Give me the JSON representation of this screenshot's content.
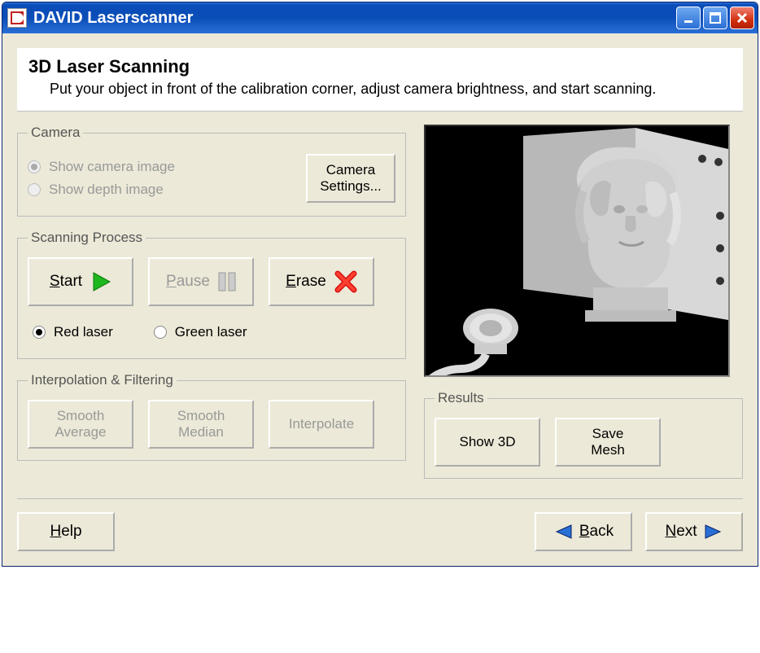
{
  "window": {
    "title": "DAVID Laserscanner"
  },
  "header": {
    "title": "3D Laser Scanning",
    "description": "Put your object in front of the calibration corner, adjust camera brightness, and start scanning."
  },
  "camera": {
    "legend": "Camera",
    "show_camera_label": "Show camera image",
    "show_depth_label": "Show depth image",
    "selected": "camera",
    "settings_button": "Camera\nSettings..."
  },
  "scanning": {
    "legend": "Scanning Process",
    "start_label": "Start",
    "pause_label": "Pause",
    "erase_label": "Erase",
    "laser": {
      "red_label": "Red laser",
      "green_label": "Green laser",
      "selected": "red"
    }
  },
  "interp": {
    "legend": "Interpolation & Filtering",
    "smooth_avg_label": "Smooth\nAverage",
    "smooth_med_label": "Smooth\nMedian",
    "interpolate_label": "Interpolate"
  },
  "results": {
    "legend": "Results",
    "show3d_label": "Show 3D",
    "save_mesh_label": "Save\nMesh"
  },
  "footer": {
    "help_label": "Help",
    "back_label": "Back",
    "next_label": "Next"
  }
}
